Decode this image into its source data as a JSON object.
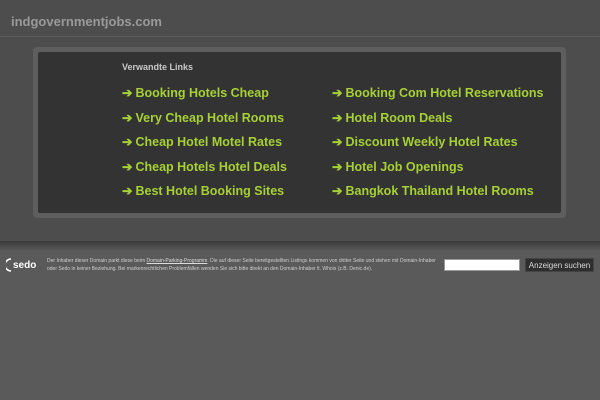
{
  "header": {
    "domain": "indgovernmentjobs.com"
  },
  "panel": {
    "title": "Verwandte Links",
    "arrow": "➔",
    "left_links": [
      "Booking Hotels Cheap",
      "Very Cheap Hotel Rooms",
      "Cheap Hotel Motel Rates",
      "Cheap Hotels Hotel Deals",
      "Best Hotel Booking Sites"
    ],
    "right_links": [
      "Booking Com Hotel Reservations",
      "Hotel Room Deals",
      "Discount Weekly Hotel Rates",
      "Hotel Job Openings",
      "Bangkok Thailand Hotel Rooms"
    ]
  },
  "footer": {
    "logo_text": "sedo",
    "text_before": "Der Inhaber dieser Domain parkt diese beim ",
    "program_link": "Domain-Parking-Programm",
    "text_after": ". Die auf dieser Seite bereitgestellten Listings kommen von dritter Seite und stehen mit Domain-Inhaber oder Sedo in keiner Beziehung. Bei markenrechtlichen Problemfällen wenden Sie sich bitte direkt an den Domain-Inhaber lt. Whois (z.B. Denic.de).",
    "search_value": "",
    "search_button": "Anzeigen suchen"
  },
  "colors": {
    "link": "#a6d035",
    "background": "#5a5a5a",
    "panel": "#333333"
  }
}
